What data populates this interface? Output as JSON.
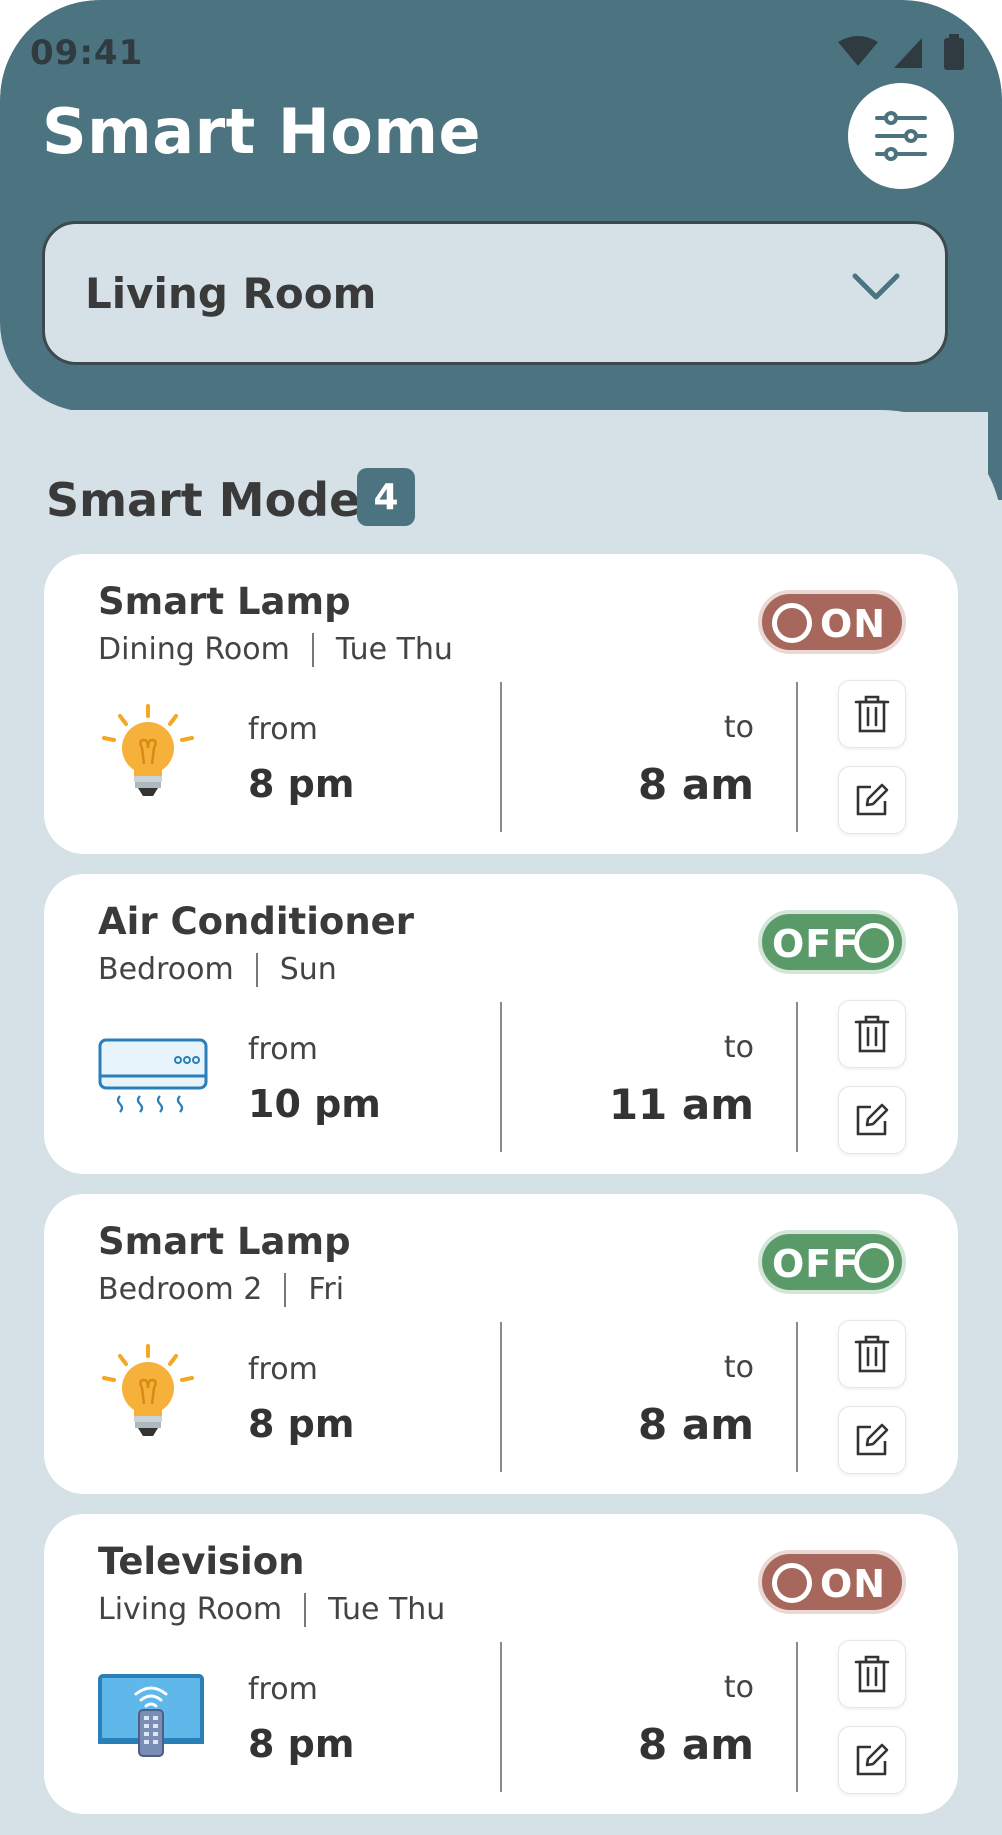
{
  "status_bar": {
    "time": "09:41"
  },
  "header": {
    "title": "Smart Home"
  },
  "room_select": {
    "value": "Living Room"
  },
  "section": {
    "title": "Smart Mode",
    "count": "4"
  },
  "colors": {
    "header": "#4c7380",
    "background": "#d5e1e6",
    "on": "#a7675d",
    "off": "#5a9a69"
  },
  "schedules": [
    {
      "device": "Smart Lamp",
      "room": "Dining Room",
      "days": "Tue Thu",
      "state": "ON",
      "from_label": "from",
      "from": "8 pm",
      "to_label": "to",
      "to": "8 am",
      "icon": "lightbulb-icon"
    },
    {
      "device": "Air Conditioner",
      "room": "Bedroom",
      "days": "Sun",
      "state": "OFF",
      "from_label": "from",
      "from": "10 pm",
      "to_label": "to",
      "to": "11 am",
      "icon": "air-conditioner-icon"
    },
    {
      "device": "Smart Lamp",
      "room": "Bedroom 2",
      "days": "Fri",
      "state": "OFF",
      "from_label": "from",
      "from": "8 pm",
      "to_label": "to",
      "to": "8 am",
      "icon": "lightbulb-icon"
    },
    {
      "device": "Television",
      "room": "Living Room",
      "days": "Tue Thu",
      "state": "ON",
      "from_label": "from",
      "from": "8 pm",
      "to_label": "to",
      "to": "8 am",
      "icon": "television-icon"
    }
  ]
}
